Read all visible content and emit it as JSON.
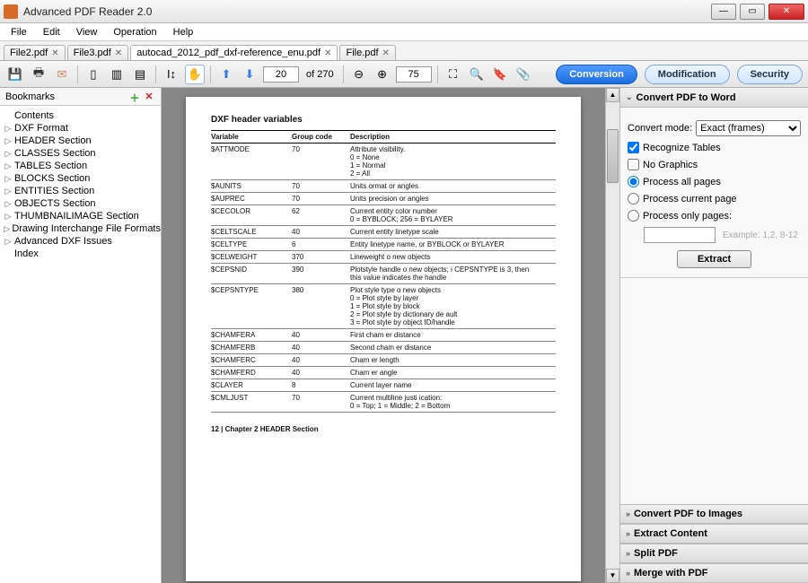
{
  "window": {
    "title": "Advanced PDF Reader 2.0"
  },
  "menus": [
    "File",
    "Edit",
    "View",
    "Operation",
    "Help"
  ],
  "tabs": [
    {
      "label": "File2.pdf",
      "active": false
    },
    {
      "label": "File3.pdf",
      "active": false
    },
    {
      "label": "autocad_2012_pdf_dxf-reference_enu.pdf",
      "active": true
    },
    {
      "label": "File.pdf",
      "active": false
    }
  ],
  "toolbar": {
    "page_current": "20",
    "page_total_label": "of 270",
    "zoom_value": "75"
  },
  "mode_buttons": {
    "conversion": "Conversion",
    "modification": "Modification",
    "security": "Security"
  },
  "bookmarks": {
    "title": "Bookmarks",
    "items": [
      {
        "exp": "",
        "label": "Contents"
      },
      {
        "exp": "▷",
        "label": "DXF Format"
      },
      {
        "exp": "▷",
        "label": "HEADER Section"
      },
      {
        "exp": "▷",
        "label": "CLASSES Section"
      },
      {
        "exp": "▷",
        "label": "TABLES Section"
      },
      {
        "exp": "▷",
        "label": "BLOCKS Section"
      },
      {
        "exp": "▷",
        "label": "ENTITIES Section"
      },
      {
        "exp": "▷",
        "label": "OBJECTS Section"
      },
      {
        "exp": "▷",
        "label": "THUMBNAILIMAGE Section"
      },
      {
        "exp": "▷",
        "label": "Drawing Interchange File Formats"
      },
      {
        "exp": "▷",
        "label": "Advanced DXF Issues"
      },
      {
        "exp": "",
        "label": "Index"
      }
    ]
  },
  "page": {
    "title": "DXF header variables",
    "col1": "Variable",
    "col2": "Group code",
    "col3": "Description",
    "footer": "12 | Chapter 2   HEADER Section",
    "rows": [
      {
        "v": "$ATTMODE",
        "c": "70",
        "d": "Attribute visibility.\n0 = None\n1 = Normal\n2 = All"
      },
      {
        "v": "$AUNITS",
        "c": "70",
        "d": "Units  ormat  or angles"
      },
      {
        "v": "$AUPREC",
        "c": "70",
        "d": "Units precision  or angles"
      },
      {
        "v": "$CECOLOR",
        "c": "62",
        "d": "Current entity color number\n0 = BYBLOCK; 256 = BYLAYER"
      },
      {
        "v": "$CELTSCALE",
        "c": "40",
        "d": "Current entity linetype scale"
      },
      {
        "v": "$CELTYPE",
        "c": "6",
        "d": "Entity linetype name, or BYBLOCK or BYLAYER"
      },
      {
        "v": "$CELWEIGHT",
        "c": "370",
        "d": "Lineweight o  new objects"
      },
      {
        "v": "$CEPSNID",
        "c": "390",
        "d": "Plotstyle handle o  new objects; i  CEPSNTYPE is 3, then\nthis value indicates the handle"
      },
      {
        "v": "$CEPSNTYPE",
        "c": "380",
        "d": "Plot style type o  new objects\n0 = Plot style by layer\n1 = Plot style by block\n2 = Plot style by dictionary de ault\n3 = Plot style by object ID/handle"
      },
      {
        "v": "$CHAMFERA",
        "c": "40",
        "d": "First cham er distance"
      },
      {
        "v": "$CHAMFERB",
        "c": "40",
        "d": "Second cham er distance"
      },
      {
        "v": "$CHAMFERC",
        "c": "40",
        "d": "Cham er length"
      },
      {
        "v": "$CHAMFERD",
        "c": "40",
        "d": "Cham er angle"
      },
      {
        "v": "$CLAYER",
        "c": "8",
        "d": "Current layer name"
      },
      {
        "v": "$CMLJUST",
        "c": "70",
        "d": "Current multiline justi ication:\n0 = Top; 1 = Middle; 2 = Bottom"
      }
    ]
  },
  "rightpanel": {
    "section1": {
      "title": "Convert PDF to Word",
      "mode_label": "Convert mode:",
      "mode_value": "Exact (frames)",
      "recognize_tables": "Recognize Tables",
      "no_graphics": "No Graphics",
      "all_pages": "Process all pages",
      "current_page": "Process current page",
      "only_pages": "Process only pages:",
      "pages_hint": "Example: 1,2, 8-12",
      "extract_btn": "Extract"
    },
    "others": [
      "Convert PDF to Images",
      "Extract Content",
      "Split PDF",
      "Merge with PDF"
    ]
  }
}
